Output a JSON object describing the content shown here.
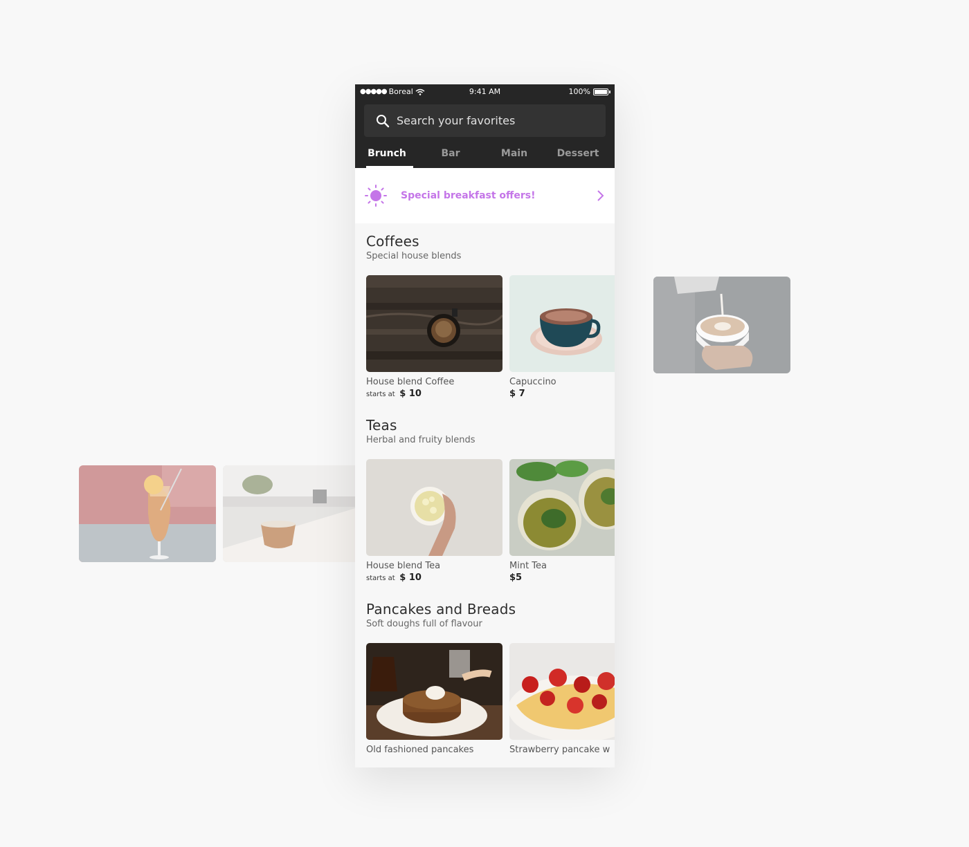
{
  "status_bar": {
    "carrier": "Boreal",
    "signal_dots": "●●●●●",
    "time": "9:41 AM",
    "battery": "100%"
  },
  "search": {
    "placeholder": "Search your favorites"
  },
  "tabs": [
    {
      "label": "Brunch",
      "active": true
    },
    {
      "label": "Bar",
      "active": false
    },
    {
      "label": "Main",
      "active": false
    },
    {
      "label": "Dessert",
      "active": false
    }
  ],
  "offer": {
    "label": "Special breakfast offers!",
    "accent": "#c475e8"
  },
  "sections": [
    {
      "title": "Coffees",
      "subtitle": "Special house blends",
      "items": [
        {
          "name": "House blend Coffee",
          "price_prefix": "starts at",
          "price": "$ 10"
        },
        {
          "name": "Capuccino",
          "price_prefix": "",
          "price": "$ 7"
        }
      ]
    },
    {
      "title": "Teas",
      "subtitle": "Herbal and fruity blends",
      "items": [
        {
          "name": "House blend Tea",
          "price_prefix": "starts at",
          "price": "$ 10"
        },
        {
          "name": "Mint Tea",
          "price_prefix": "",
          "price": "$5"
        }
      ]
    },
    {
      "title": "Pancakes and Breads",
      "subtitle": "Soft doughs full of flavour",
      "items": [
        {
          "name": "Old fashioned pancakes"
        },
        {
          "name": "Strawberry pancake w"
        }
      ]
    }
  ],
  "colors": {
    "topbar": "#262626",
    "search_bg": "#333333",
    "background": "#f7f7f7",
    "accent": "#c475e8"
  }
}
